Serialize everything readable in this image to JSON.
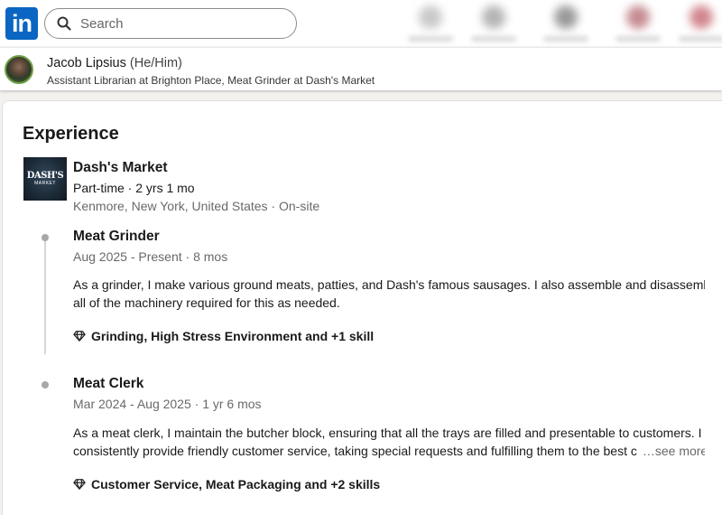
{
  "nav": {
    "logo_text": "in",
    "brand_color": "#0a66c2",
    "search_placeholder": "Search"
  },
  "profile": {
    "name": "Jacob Lipsius",
    "pronouns": "(He/Him)",
    "headline": "Assistant Librarian at Brighton Place, Meat Grinder at Dash's Market"
  },
  "experience": {
    "title": "Experience",
    "company": {
      "logo_line1": "DASH'S",
      "logo_line2": "MARKET",
      "name": "Dash's Market",
      "meta": "Part-time · 2 yrs 1 mo",
      "location": "Kenmore, New York, United States · On-site"
    },
    "positions": [
      {
        "title": "Meat Grinder",
        "dates": "Aug 2025 - Present · 8 mos",
        "description_lines": [
          "As a grinder, I make various ground meats, patties, and Dash's famous sausages. I also assemble and disassemble",
          "all of the machinery required for this as needed."
        ],
        "skills": "Grinding, High Stress Environment and +1 skill"
      },
      {
        "title": "Meat Clerk",
        "dates": "Mar 2024 - Aug 2025 · 1 yr 6 mos",
        "description_lines": [
          "As a meat clerk, I maintain the butcher block, ensuring that all the trays are filled and presentable to customers. I",
          "consistently provide friendly customer service, taking special requests and fulfilling them to the best c"
        ],
        "see_more": "…see more",
        "skills": "Customer Service, Meat Packaging and +2 skills"
      }
    ]
  }
}
